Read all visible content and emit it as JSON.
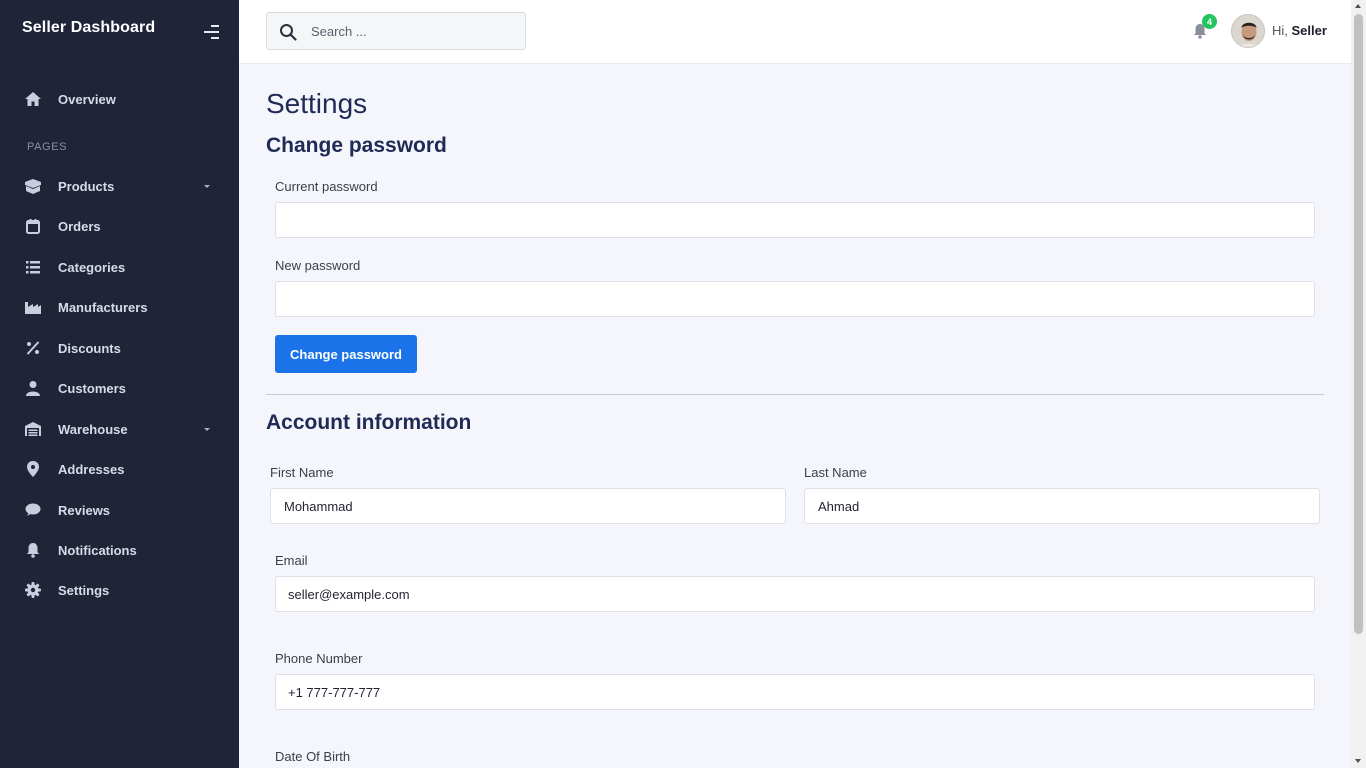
{
  "sidebar": {
    "brand": "Seller Dashboard",
    "section_label": "PAGES",
    "items": [
      {
        "label": "Overview",
        "icon": "home-icon"
      },
      {
        "label": "Products",
        "icon": "box-icon",
        "has_caret": true
      },
      {
        "label": "Orders",
        "icon": "calendar-icon"
      },
      {
        "label": "Categories",
        "icon": "list-icon"
      },
      {
        "label": "Manufacturers",
        "icon": "factory-icon"
      },
      {
        "label": "Discounts",
        "icon": "percent-icon"
      },
      {
        "label": "Customers",
        "icon": "user-icon"
      },
      {
        "label": "Warehouse",
        "icon": "warehouse-icon",
        "has_caret": true
      },
      {
        "label": "Addresses",
        "icon": "map-pin-icon"
      },
      {
        "label": "Reviews",
        "icon": "comment-icon"
      },
      {
        "label": "Notifications",
        "icon": "bell-icon"
      },
      {
        "label": "Settings",
        "icon": "gear-icon"
      }
    ]
  },
  "header": {
    "search_placeholder": "Search ...",
    "notification_count": "4",
    "greeting_prefix": "Hi, ",
    "user_name": "Seller"
  },
  "main": {
    "page_title": "Settings",
    "change_password": {
      "heading": "Change password",
      "current_label": "Current password",
      "current_value": "",
      "new_label": "New password",
      "new_value": "",
      "button_label": "Change password"
    },
    "account": {
      "heading": "Account information",
      "first_name_label": "First Name",
      "first_name_value": "Mohammad",
      "last_name_label": "Last Name",
      "last_name_value": "Ahmad",
      "email_label": "Email",
      "email_value": "seller@example.com",
      "phone_label": "Phone Number",
      "phone_value": "+1 777-777-777",
      "dob_label": "Date Of Birth"
    }
  },
  "colors": {
    "sidebar_bg": "#1f2438",
    "accent": "#1a73e8",
    "badge": "#22c55e",
    "content_bg": "#f4f6fb"
  }
}
